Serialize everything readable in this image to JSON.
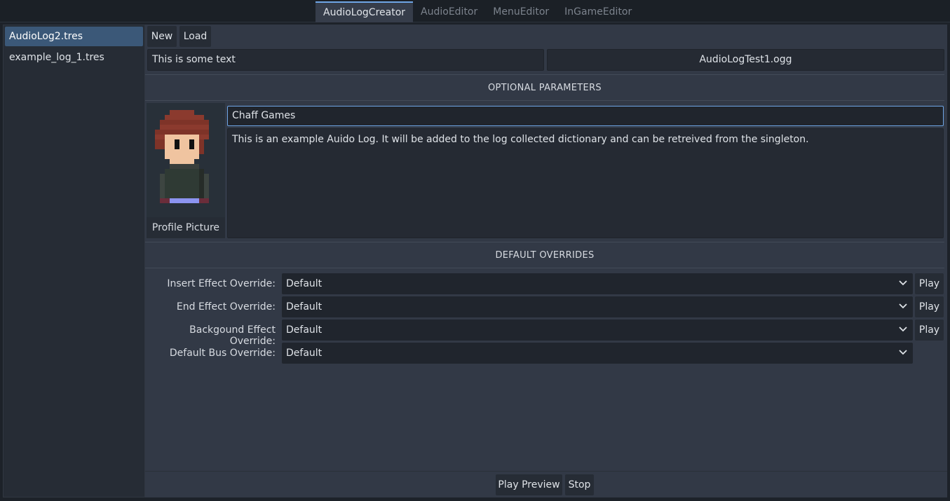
{
  "tabs": [
    {
      "label": "AudioLogCreator",
      "active": true
    },
    {
      "label": "AudioEditor",
      "active": false
    },
    {
      "label": "MenuEditor",
      "active": false
    },
    {
      "label": "InGameEditor",
      "active": false
    }
  ],
  "files": [
    {
      "label": "AudioLog2.tres",
      "selected": true
    },
    {
      "label": "example_log_1.tres",
      "selected": false
    }
  ],
  "toolbar": {
    "new_label": "New",
    "load_label": "Load"
  },
  "log": {
    "text_value": "This is some text",
    "audio_file": "AudioLogTest1.ogg"
  },
  "optional": {
    "section_title": "OPTIONAL PARAMETERS",
    "profile_picture_label": "Profile Picture",
    "author_value": "Chaff Games",
    "description_value": "This is an example Auido Log. It will be added to the log collected dictionary and can be retreived from the singleton."
  },
  "overrides": {
    "section_title": "DEFAULT OVERRIDES",
    "rows": [
      {
        "label": "Insert Effect Override:",
        "value": "Default",
        "play_label": "Play"
      },
      {
        "label": "End Effect Override:",
        "value": "Default",
        "play_label": "Play"
      },
      {
        "label": "Backgound Effect Override:",
        "value": "Default",
        "play_label": "Play"
      },
      {
        "label": "Default Bus Override:",
        "value": "Default"
      }
    ]
  },
  "footer": {
    "play_preview_label": "Play Preview",
    "stop_label": "Stop"
  },
  "icons": {
    "chevron": "chevron-down-icon"
  },
  "colors": {
    "accent": "#6fa6e6",
    "selected": "#3b5878"
  }
}
